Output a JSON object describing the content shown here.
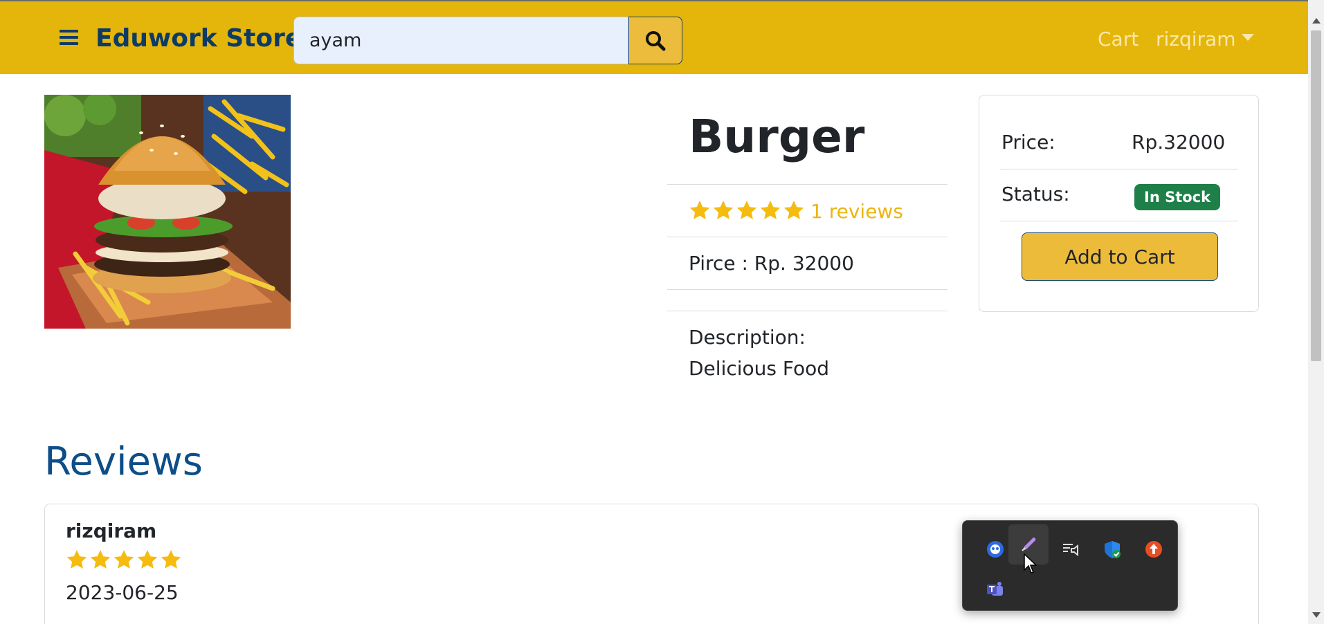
{
  "navbar": {
    "brand": "Eduwork Store",
    "search_value": "ayam",
    "cart_link": "Cart",
    "user_menu": "rizqiram",
    "bg_color": "#e4b50b"
  },
  "product": {
    "title": "Burger",
    "rating": 5,
    "rating_max": 5,
    "reviews_link": "1 reviews",
    "price_line": "Pirce : Rp. 32000",
    "description_label": "Description:",
    "description": "Delicious Food"
  },
  "price_card": {
    "price_label": "Price:",
    "price_value": "Rp.32000",
    "status_label": "Status:",
    "status_badge": "In Stock",
    "add_to_cart": "Add to Cart"
  },
  "reviews": {
    "heading": "Reviews",
    "items": [
      {
        "user": "rizqiram",
        "rating": 5,
        "date": "2023-06-25"
      }
    ]
  },
  "tray": {
    "icons": [
      "copilot-icon",
      "pen-icon",
      "media-queue-icon",
      "windows-security-icon",
      "upload-icon",
      "teams-icon"
    ]
  },
  "colors": {
    "accent_yellow": "#ecbd3d",
    "brand_blue": "#0d3b66",
    "star_color": "#f5bb0e",
    "badge_green": "#1e8048"
  }
}
